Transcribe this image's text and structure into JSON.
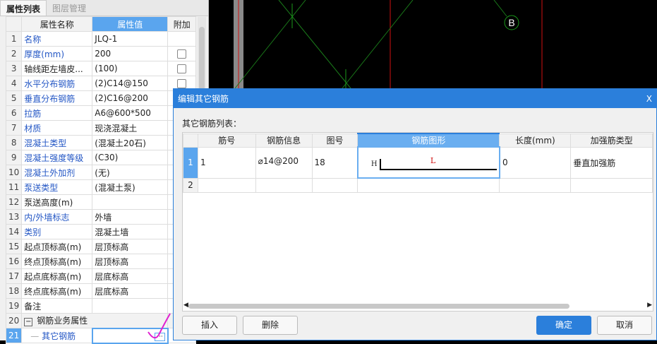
{
  "tabs": [
    "属性列表",
    "图层管理"
  ],
  "prop_headers": {
    "num": "",
    "name": "属性名称",
    "value": "属性值",
    "extra": "附加"
  },
  "props": [
    {
      "n": "1",
      "name": "名称",
      "value": "JLQ-1",
      "blue": true,
      "cb": false
    },
    {
      "n": "2",
      "name": "厚度(mm)",
      "value": "200",
      "blue": true,
      "cb": true
    },
    {
      "n": "3",
      "name": "轴线距左墙皮...",
      "value": "(100)",
      "blue": false,
      "cb": true
    },
    {
      "n": "4",
      "name": "水平分布钢筋",
      "value": "(2)C14@150",
      "blue": true,
      "cb": true
    },
    {
      "n": "5",
      "name": "垂直分布钢筋",
      "value": "(2)C16@200",
      "blue": true,
      "cb": false
    },
    {
      "n": "6",
      "name": "拉筋",
      "value": "A6@600*500",
      "blue": true,
      "cb": false
    },
    {
      "n": "7",
      "name": "材质",
      "value": "现浇混凝土",
      "blue": true,
      "cb": false
    },
    {
      "n": "8",
      "name": "混凝土类型",
      "value": "(混凝土20石)",
      "blue": true,
      "cb": false
    },
    {
      "n": "9",
      "name": "混凝土强度等级",
      "value": "(C30)",
      "blue": true,
      "cb": false
    },
    {
      "n": "10",
      "name": "混凝土外加剂",
      "value": "(无)",
      "blue": true,
      "cb": false
    },
    {
      "n": "11",
      "name": "泵送类型",
      "value": "(混凝土泵)",
      "blue": true,
      "cb": false
    },
    {
      "n": "12",
      "name": "泵送高度(m)",
      "value": "",
      "blue": false,
      "cb": false
    },
    {
      "n": "13",
      "name": "内/外墙标志",
      "value": "外墙",
      "blue": true,
      "cb": false
    },
    {
      "n": "14",
      "name": "类别",
      "value": "混凝土墙",
      "blue": true,
      "cb": false
    },
    {
      "n": "15",
      "name": "起点顶标高(m)",
      "value": "层顶标高",
      "blue": false,
      "cb": false
    },
    {
      "n": "16",
      "name": "终点顶标高(m)",
      "value": "层顶标高",
      "blue": false,
      "cb": false
    },
    {
      "n": "17",
      "name": "起点底标高(m)",
      "value": "层底标高",
      "blue": false,
      "cb": false
    },
    {
      "n": "18",
      "name": "终点底标高(m)",
      "value": "层底标高",
      "blue": false,
      "cb": false
    },
    {
      "n": "19",
      "name": "备注",
      "value": "",
      "blue": false,
      "cb": false
    }
  ],
  "group_row": {
    "n": "20",
    "toggle": "−",
    "name": "钢筋业务属性"
  },
  "selected_row": {
    "n": "21",
    "name": "其它钢筋",
    "button": "···"
  },
  "canvas": {
    "axis_label": "B"
  },
  "dialog": {
    "title": "编辑其它钢筋",
    "close": "X",
    "list_label": "其它钢筋列表：",
    "headers": [
      "",
      "筋号",
      "钢筋信息",
      "图号",
      "钢筋图形",
      "长度(mm)",
      "加强筋类型"
    ],
    "rows": [
      {
        "n": "1",
        "jh": "1",
        "info": "⌀14@200",
        "tuhao": "18",
        "shape_h": "H",
        "shape_l": "L",
        "length": "0",
        "type": "垂直加强筋"
      },
      {
        "n": "2",
        "jh": "",
        "info": "",
        "tuhao": "",
        "shape_h": "",
        "shape_l": "",
        "length": "",
        "type": ""
      }
    ],
    "buttons": {
      "insert": "插入",
      "delete": "删除",
      "ok": "确定",
      "cancel": "取消"
    }
  }
}
